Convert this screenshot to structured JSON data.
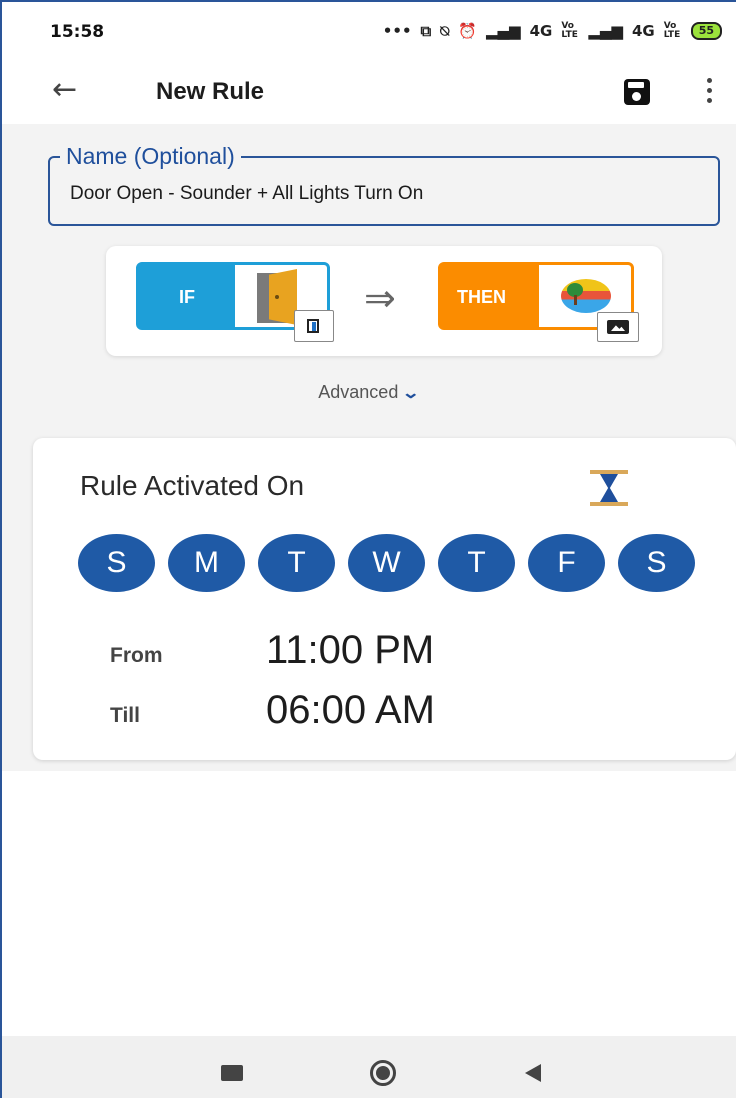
{
  "status_bar": {
    "time": "15:58",
    "icons": [
      "more-dots-icon",
      "screenshot-icon",
      "mute-icon",
      "alarm-icon",
      "signal-icon"
    ],
    "net1": "4G",
    "net2": "4G",
    "volte1": "Vo LTE",
    "volte2": "Vo LTE",
    "battery": "55"
  },
  "app_bar": {
    "title": "New Rule",
    "back_icon": "arrow-left",
    "save_icon": "floppy-disk",
    "more_icon": "vertical-dots"
  },
  "name_field": {
    "label": "Name (Optional)",
    "value": "Door Open - Sounder + All Lights Turn On"
  },
  "rule": {
    "if_label": "IF",
    "then_label": "THEN",
    "arrow": "⇒"
  },
  "advanced": {
    "label": "Advanced",
    "chevron": "⌄"
  },
  "schedule": {
    "title": "Rule Activated On",
    "days": [
      "S",
      "M",
      "T",
      "W",
      "T",
      "F",
      "S"
    ],
    "from_label": "From",
    "from_value": "11:00 PM",
    "till_label": "Till",
    "till_value": "06:00 AM"
  },
  "colors": {
    "accent_blue": "#1f5aa6",
    "if_blue": "#1e9fd8",
    "then_orange": "#fb8c00"
  }
}
